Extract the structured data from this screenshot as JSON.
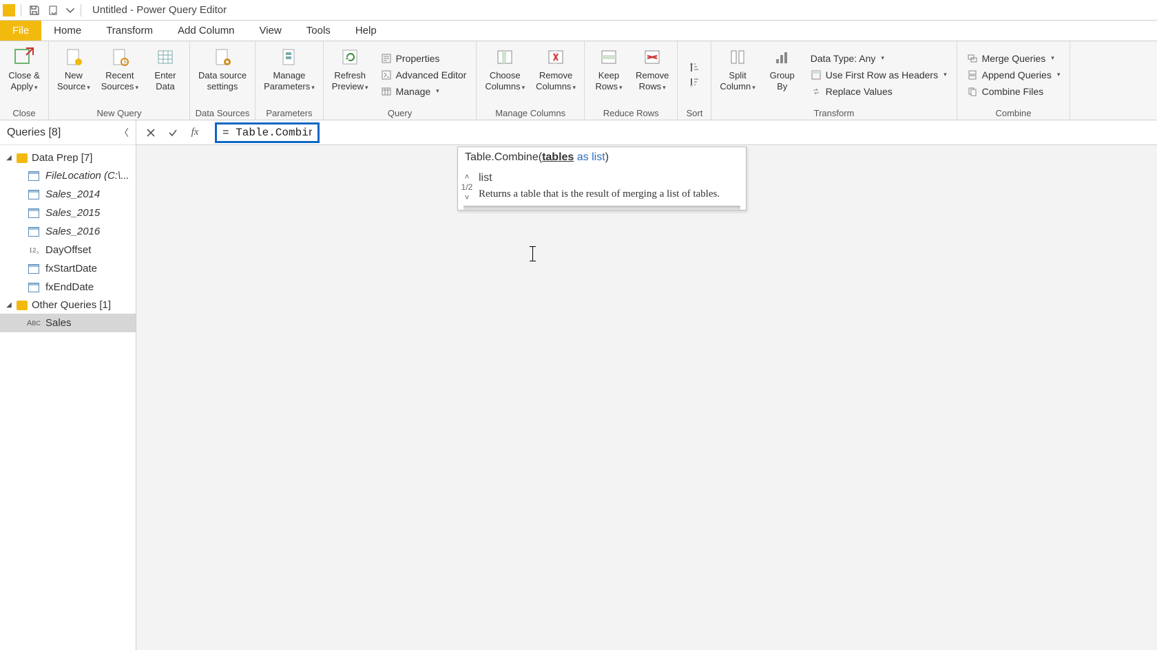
{
  "window": {
    "title": "Untitled - Power Query Editor"
  },
  "tabs": {
    "file": "File",
    "home": "Home",
    "transform": "Transform",
    "addcol": "Add Column",
    "view": "View",
    "tools": "Tools",
    "help": "Help"
  },
  "ribbon": {
    "close_group": "Close",
    "close_apply": "Close &\nApply",
    "newquery_group": "New Query",
    "new_source": "New\nSource",
    "recent_sources": "Recent\nSources",
    "enter_data": "Enter\nData",
    "datasources_group": "Data Sources",
    "data_source_settings": "Data source\nsettings",
    "parameters_group": "Parameters",
    "manage_parameters": "Manage\nParameters",
    "query_group": "Query",
    "refresh_preview": "Refresh\nPreview",
    "properties": "Properties",
    "advanced_editor": "Advanced Editor",
    "manage": "Manage",
    "managecols_group": "Manage Columns",
    "choose_columns": "Choose\nColumns",
    "remove_columns": "Remove\nColumns",
    "reducerows_group": "Reduce Rows",
    "keep_rows": "Keep\nRows",
    "remove_rows": "Remove\nRows",
    "sort_group": "Sort",
    "transform_group": "Transform",
    "split_column": "Split\nColumn",
    "group_by": "Group\nBy",
    "data_type": "Data Type: Any",
    "first_row_headers": "Use First Row as Headers",
    "replace_values": "Replace Values",
    "combine_group": "Combine",
    "merge_queries": "Merge Queries",
    "append_queries": "Append Queries",
    "combine_files": "Combine Files"
  },
  "queries_panel": {
    "title": "Queries [8]",
    "folders": [
      {
        "label": "Data Prep [7]",
        "items": [
          {
            "label": "FileLocation (C:\\...",
            "icon": "table",
            "italic": true
          },
          {
            "label": "Sales_2014",
            "icon": "table",
            "italic": true
          },
          {
            "label": "Sales_2015",
            "icon": "table",
            "italic": true
          },
          {
            "label": "Sales_2016",
            "icon": "table",
            "italic": true
          },
          {
            "label": "DayOffset",
            "icon": "num",
            "italic": false
          },
          {
            "label": "fxStartDate",
            "icon": "table",
            "italic": false
          },
          {
            "label": "fxEndDate",
            "icon": "table",
            "italic": false
          }
        ]
      },
      {
        "label": "Other Queries [1]",
        "items": [
          {
            "label": "Sales",
            "icon": "abc",
            "italic": false,
            "selected": true
          }
        ]
      }
    ]
  },
  "formula": {
    "text": "= Table.Combine()"
  },
  "tooltip": {
    "sig_prefix": "Table.Combine(",
    "sig_param": "tables",
    "sig_as": " as ",
    "sig_type": "list",
    "sig_suffix": ")",
    "nav_count": "1/2",
    "type_line": "list",
    "desc": "Returns a table that is the result of merging a list of tables."
  }
}
